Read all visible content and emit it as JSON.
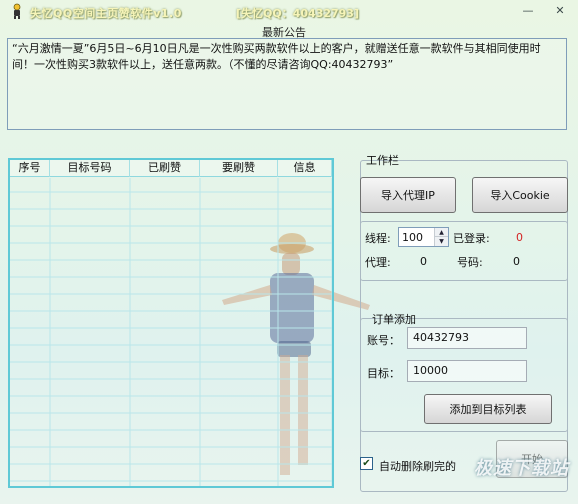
{
  "window": {
    "title": "失忆QQ空间主页赞软件v1.0",
    "title_qq": "[失忆QQ：40432793]",
    "min_glyph": "—",
    "close_glyph": "✕"
  },
  "announcement": {
    "title": "最新公告",
    "text": "“六月激情一夏”6月5日~6月10日凡是一次性购买两款软件以上的客户，就赠送任意一款软件与其相同使用时间！一次性购买3款软件以上，送任意两款。（不懂的尽请咨询QQ:40432793”"
  },
  "table": {
    "columns": [
      "序号",
      "目标号码",
      "已刷赞",
      "要刷赞",
      "信息"
    ],
    "rows": []
  },
  "toolbox": {
    "title": "工作栏",
    "import_proxy_label": "导入代理IP",
    "import_cookie_label": "导入Cookie",
    "threads_label": "线程:",
    "threads_value": "100",
    "logged_in_label": "已登录:",
    "logged_in_value": "0",
    "proxy_label": "代理:",
    "proxy_value": "0",
    "number_label": "号码:",
    "number_value": "0"
  },
  "order": {
    "title": "订单添加",
    "account_label": "账号：",
    "account_value": "40432793",
    "target_label": "目标：",
    "target_value": "10000",
    "add_button_label": "添加到目标列表"
  },
  "footer": {
    "auto_delete_label": "自动删除刷完的",
    "auto_delete_checked": true,
    "run_button_label": "开始",
    "watermark_text": "极速下载站"
  },
  "icons": {
    "app": "person-icon",
    "check": "checkmark-icon"
  }
}
